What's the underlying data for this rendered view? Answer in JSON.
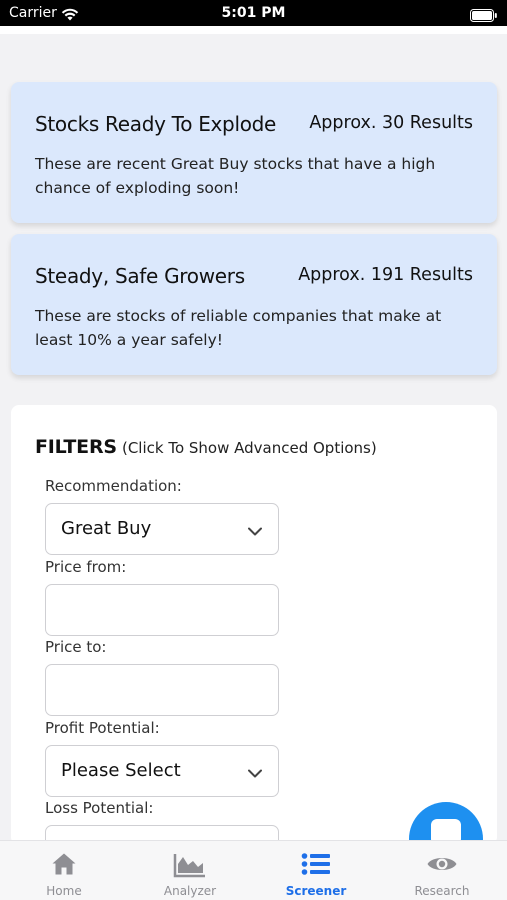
{
  "status_bar": {
    "carrier": "Carrier",
    "time": "5:01 PM",
    "icons": [
      "wifi-icon",
      "battery-icon"
    ]
  },
  "screens": [
    {
      "title": "Stocks Ready To Explode",
      "count": "Approx. 30 Results",
      "description": "These are recent Great Buy stocks that have a high chance of exploding soon!"
    },
    {
      "title": "Steady, Safe Growers",
      "count": "Approx. 191 Results",
      "description": "These are stocks of reliable companies that make at least 10% a year safely!"
    }
  ],
  "filters": {
    "title": "FILTERS",
    "subtitle": "(Click To Show Advanced Options)",
    "recommendation": {
      "label": "Recommendation:",
      "value": "Great Buy"
    },
    "price_from": {
      "label": "Price from:",
      "value": ""
    },
    "price_to": {
      "label": "Price to:",
      "value": ""
    },
    "profit_potential": {
      "label": "Profit Potential:",
      "value": "Please Select"
    },
    "loss_potential": {
      "label": "Loss Potential:"
    }
  },
  "tabs": [
    {
      "label": "Home",
      "icon": "home-icon",
      "active": false
    },
    {
      "label": "Analyzer",
      "icon": "area-chart-icon",
      "active": false
    },
    {
      "label": "Screener",
      "icon": "list-icon",
      "active": true
    },
    {
      "label": "Research",
      "icon": "eye-icon",
      "active": false
    }
  ],
  "colors": {
    "card_bg": "#dbe8fc",
    "accent": "#1e6fe8",
    "fab": "#1e90f0",
    "tab_inactive": "#8e8e93"
  }
}
